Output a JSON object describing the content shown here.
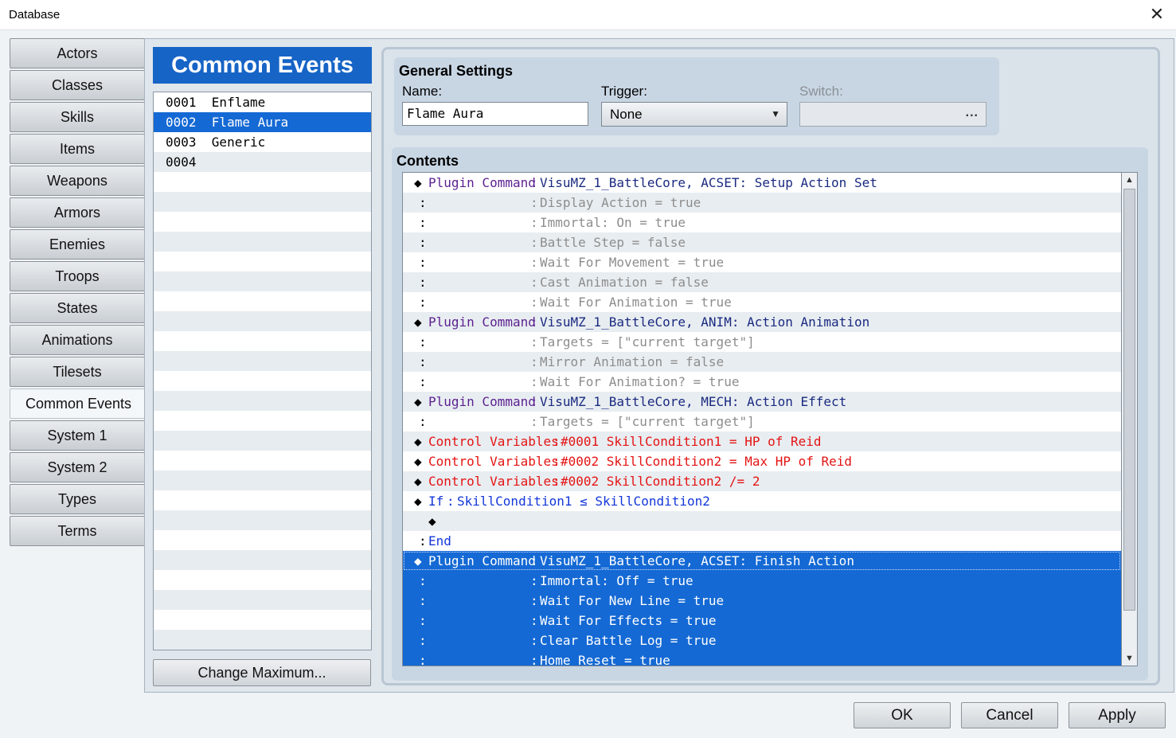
{
  "window": {
    "title": "Database",
    "close_glyph": "✕"
  },
  "sidebar": {
    "items": [
      {
        "label": "Actors"
      },
      {
        "label": "Classes"
      },
      {
        "label": "Skills"
      },
      {
        "label": "Items"
      },
      {
        "label": "Weapons"
      },
      {
        "label": "Armors"
      },
      {
        "label": "Enemies"
      },
      {
        "label": "Troops"
      },
      {
        "label": "States"
      },
      {
        "label": "Animations"
      },
      {
        "label": "Tilesets"
      },
      {
        "label": "Common Events",
        "active": true
      },
      {
        "label": "System 1"
      },
      {
        "label": "System 2"
      },
      {
        "label": "Types"
      },
      {
        "label": "Terms"
      }
    ]
  },
  "event_list": {
    "header": "Common Events",
    "rows": [
      "0001  Enflame",
      "0002  Flame Aura",
      "0003  Generic",
      "0004"
    ],
    "selected_index": 1,
    "change_max_label": "Change Maximum..."
  },
  "general": {
    "title": "General Settings",
    "name_label": "Name:",
    "name_value": "Flame Aura",
    "trigger_label": "Trigger:",
    "trigger_value": "None",
    "switch_label": "Switch:",
    "switch_button": "..."
  },
  "contents": {
    "title": "Contents",
    "commands": [
      {
        "kind": "plugin",
        "label": "Plugin Command",
        "value": "VisuMZ_1_BattleCore, ACSET: Setup Action Set"
      },
      {
        "kind": "sub",
        "value": "Display Action = true"
      },
      {
        "kind": "sub",
        "value": "Immortal: On = true"
      },
      {
        "kind": "sub",
        "value": "Battle Step = false"
      },
      {
        "kind": "sub",
        "value": "Wait For Movement = true"
      },
      {
        "kind": "sub",
        "value": "Cast Animation = false"
      },
      {
        "kind": "sub",
        "value": "Wait For Animation = true"
      },
      {
        "kind": "plugin",
        "label": "Plugin Command",
        "value": "VisuMZ_1_BattleCore, ANIM: Action Animation"
      },
      {
        "kind": "sub",
        "value": "Targets = [\"current target\"]"
      },
      {
        "kind": "sub",
        "value": "Mirror Animation = false"
      },
      {
        "kind": "sub",
        "value": "Wait For Animation? = true"
      },
      {
        "kind": "plugin",
        "label": "Plugin Command",
        "value": "VisuMZ_1_BattleCore, MECH: Action Effect"
      },
      {
        "kind": "sub",
        "value": "Targets = [\"current target\"]"
      },
      {
        "kind": "var",
        "label": "Control Variables",
        "value": "#0001 SkillCondition1 = HP of Reid"
      },
      {
        "kind": "var",
        "label": "Control Variables",
        "value": "#0002 SkillCondition2 = Max HP of Reid"
      },
      {
        "kind": "var",
        "label": "Control Variables",
        "value": "#0002 SkillCondition2 /= 2"
      },
      {
        "kind": "if",
        "label": "If",
        "value": "SkillCondition1 ≤ SkillCondition2"
      },
      {
        "kind": "inner"
      },
      {
        "kind": "end",
        "label": "End"
      },
      {
        "kind": "plugin",
        "label": "Plugin Command",
        "value": "VisuMZ_1_BattleCore, ACSET: Finish Action",
        "selected": true
      },
      {
        "kind": "sub",
        "value": "Immortal: Off = true",
        "selected": true
      },
      {
        "kind": "sub",
        "value": "Wait For New Line = true",
        "selected": true
      },
      {
        "kind": "sub",
        "value": "Wait For Effects = true",
        "selected": true
      },
      {
        "kind": "sub",
        "value": "Clear Battle Log = true",
        "selected": true
      },
      {
        "kind": "sub",
        "value": "Home Reset = true",
        "selected": true
      }
    ]
  },
  "footer": {
    "ok": "OK",
    "cancel": "Cancel",
    "apply": "Apply"
  },
  "colors": {
    "accent": "#1664c6",
    "selection": "#1469d4",
    "plugin_label": "#5c2290",
    "plugin_value": "#1a2a80",
    "sub_value": "#8d8d8d",
    "control_var": "#e41414",
    "conditional": "#1337d9"
  }
}
